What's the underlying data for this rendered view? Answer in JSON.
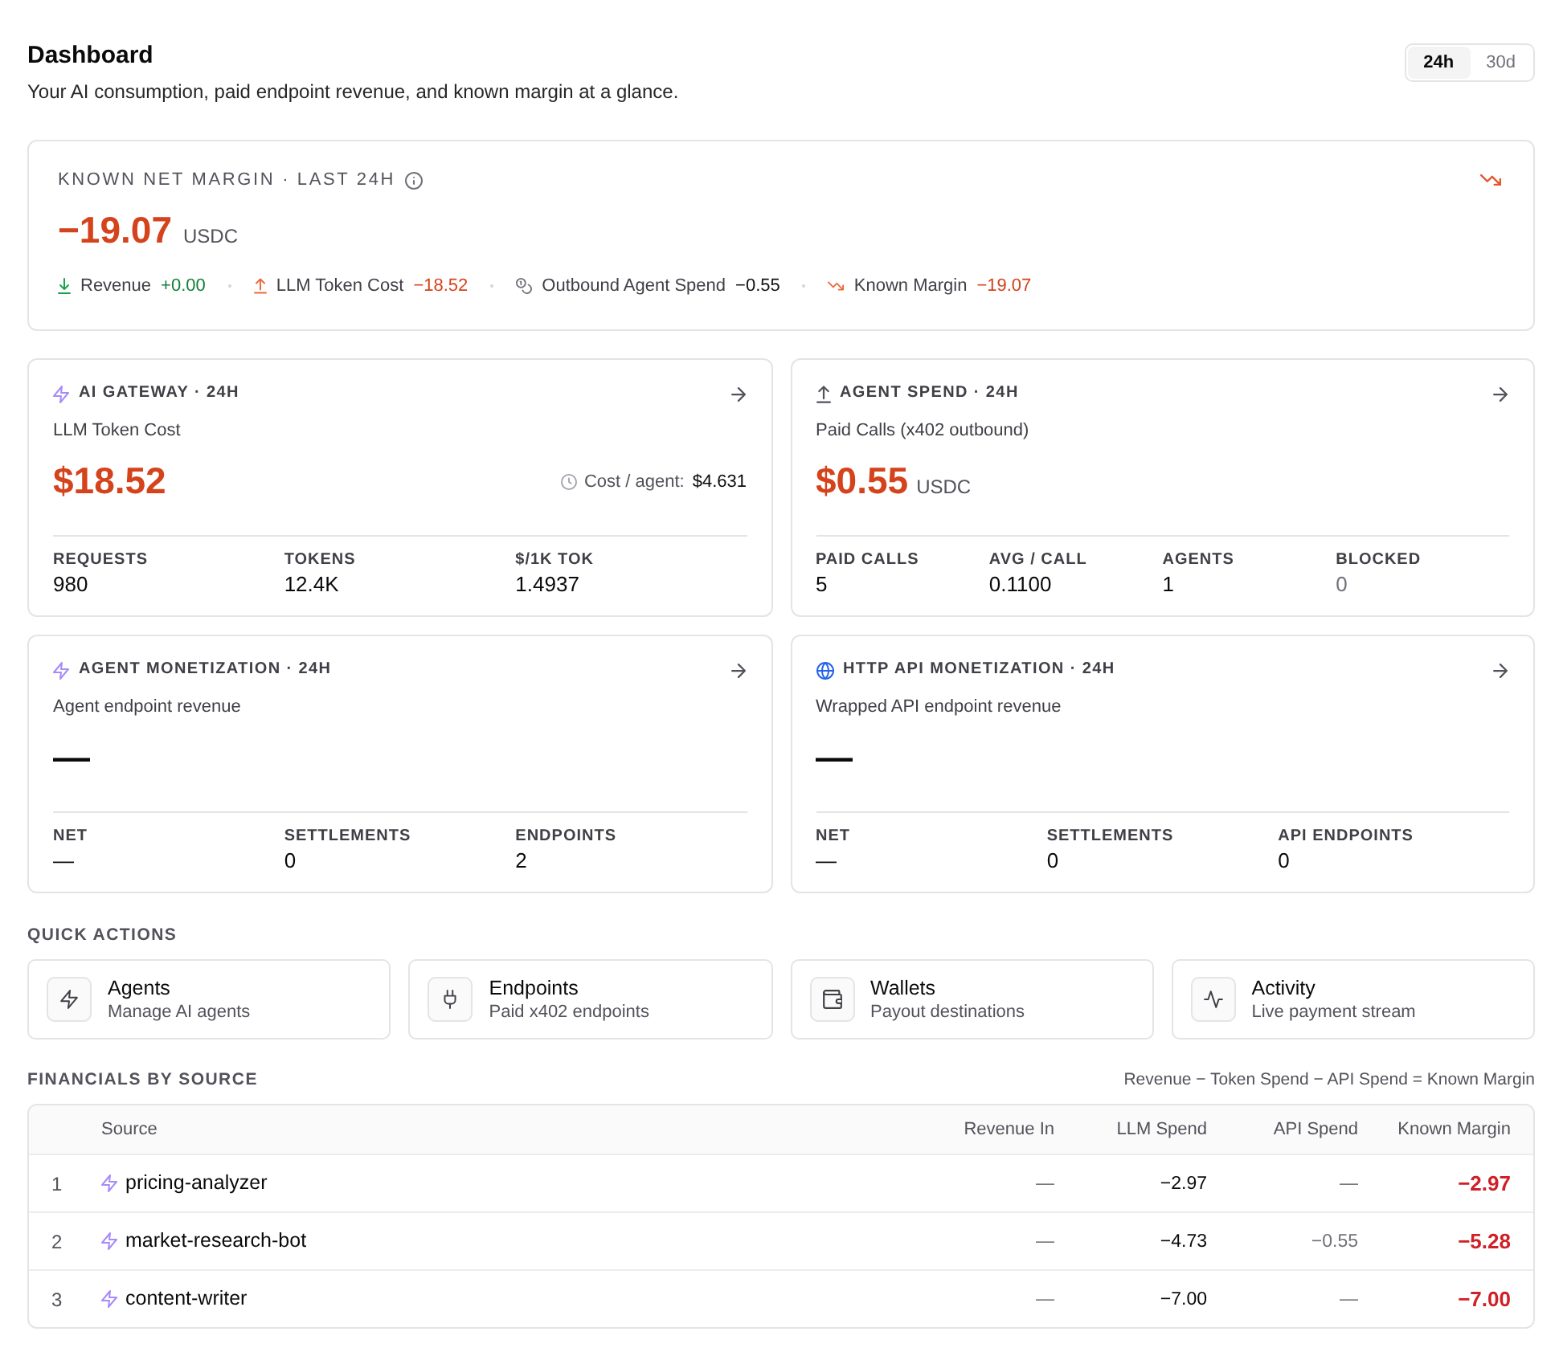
{
  "header": {
    "title": "Dashboard",
    "subtitle": "Your AI consumption, paid endpoint revenue, and known margin at a glance."
  },
  "range_tabs": [
    {
      "label": "24h",
      "selected": true
    },
    {
      "label": "30d",
      "selected": false
    }
  ],
  "margin_card": {
    "label": "KNOWN NET MARGIN · LAST 24H",
    "value": "−19.07",
    "unit": "USDC",
    "breakdown": [
      {
        "kind": "revenue",
        "label": "Revenue",
        "value": "+0.00",
        "color": "#15803d"
      },
      {
        "kind": "cost",
        "label": "LLM Token Cost",
        "value": "−18.52",
        "color": "#d4431b"
      },
      {
        "kind": "spend",
        "label": "Outbound Agent Spend",
        "value": "−0.55",
        "color": "#111111"
      },
      {
        "kind": "margin",
        "label": "Known Margin",
        "value": "−19.07",
        "color": "#d4431b"
      }
    ]
  },
  "cards": [
    {
      "kind": "gateway",
      "title": "AI GATEWAY · 24H",
      "subtitle": "LLM Token Cost",
      "value": "$18.52",
      "color": "#d4431b",
      "aside": {
        "label": "Cost / agent:",
        "value": "$4.631"
      },
      "stats": [
        {
          "label": "REQUESTS",
          "value": "980"
        },
        {
          "label": "TOKENS",
          "value": "12.4K"
        },
        {
          "label": "$/1K TOK",
          "value": "1.4937"
        }
      ]
    },
    {
      "kind": "spend",
      "title": "AGENT SPEND · 24H",
      "subtitle": "Paid Calls (x402 outbound)",
      "value": "$0.55",
      "unit": "USDC",
      "color": "#d4431b",
      "stats": [
        {
          "label": "PAID CALLS",
          "value": "5",
          "muted": false
        },
        {
          "label": "AVG / CALL",
          "value": "0.1100",
          "muted": false
        },
        {
          "label": "AGENTS",
          "value": "1",
          "muted": false
        },
        {
          "label": "BLOCKED",
          "value": "0",
          "muted": true
        }
      ]
    },
    {
      "kind": "agents",
      "title": "AGENT MONETIZATION · 24H",
      "subtitle": "Agent endpoint revenue",
      "value": "—",
      "color": "#0a0a0a",
      "stats": [
        {
          "label": "NET",
          "value": "—"
        },
        {
          "label": "SETTLEMENTS",
          "value": "0"
        },
        {
          "label": "ENDPOINTS",
          "value": "2"
        }
      ]
    },
    {
      "kind": "http",
      "title": "HTTP API MONETIZATION · 24H",
      "subtitle": "Wrapped API endpoint revenue",
      "value": "—",
      "color": "#0a0a0a",
      "stats": [
        {
          "label": "NET",
          "value": "—"
        },
        {
          "label": "SETTLEMENTS",
          "value": "0"
        },
        {
          "label": "API ENDPOINTS",
          "value": "0"
        }
      ]
    }
  ],
  "quick_actions": {
    "title": "QUICK ACTIONS",
    "items": [
      {
        "kind": "agents",
        "title": "Agents",
        "description": "Manage AI agents"
      },
      {
        "kind": "endpoints",
        "title": "Endpoints",
        "description": "Paid x402 endpoints"
      },
      {
        "kind": "wallets",
        "title": "Wallets",
        "description": "Payout destinations"
      },
      {
        "kind": "activity",
        "title": "Activity",
        "description": "Live payment stream"
      }
    ]
  },
  "financials": {
    "title": "FINANCIALS BY SOURCE",
    "formula": "Revenue − Token Spend − API Spend = Known Margin",
    "table": {
      "columns": [
        "Source",
        "Revenue In",
        "LLM Spend",
        "API Spend",
        "Known Margin"
      ],
      "rows": [
        {
          "index": "1",
          "source": "pricing-analyzer",
          "revenue_in": "—",
          "llm_spend": "−2.97",
          "api_spend": "—",
          "known_margin": "−2.97"
        },
        {
          "index": "2",
          "source": "market-research-bot",
          "revenue_in": "—",
          "llm_spend": "−4.73",
          "api_spend": "−0.55",
          "known_margin": "−5.28"
        },
        {
          "index": "3",
          "source": "content-writer",
          "revenue_in": "—",
          "llm_spend": "−7.00",
          "api_spend": "—",
          "known_margin": "−7.00"
        }
      ]
    }
  }
}
